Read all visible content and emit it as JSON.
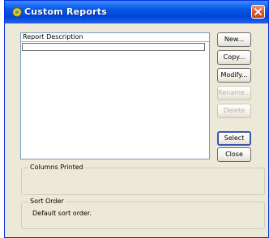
{
  "window": {
    "title": "Custom Reports"
  },
  "list": {
    "column_header": "Report Description",
    "rows": [
      ""
    ]
  },
  "buttons": {
    "new": "New...",
    "copy": "Copy...",
    "modify": "Modify...",
    "rename": "Rename...",
    "delete": "Delete",
    "select": "Select",
    "close": "Close"
  },
  "groups": {
    "columns_printed": {
      "title": "Columns Printed",
      "value": ""
    },
    "sort_order": {
      "title": "Sort Order",
      "value": "Default sort order."
    }
  },
  "colors": {
    "title_bar": "#0a5ae6",
    "window_bg": "#ece9d8",
    "close_button": "#e3582c"
  }
}
